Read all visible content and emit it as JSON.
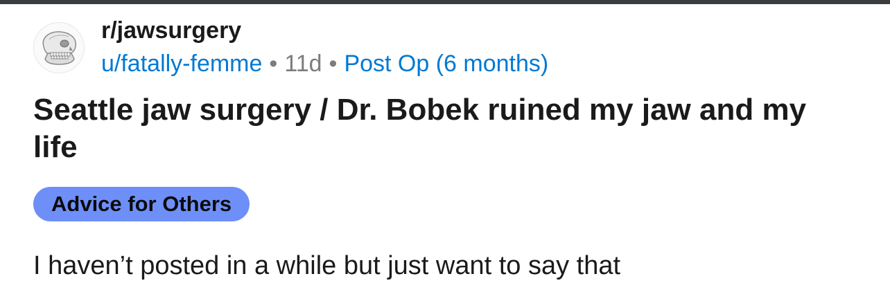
{
  "post": {
    "subreddit": "r/jawsurgery",
    "username": "u/fatally-femme",
    "separator": "•",
    "age": "11d",
    "flair": "Post Op (6 months)",
    "title": "Seattle jaw surgery / Dr. Bobek ruined my jaw and my life",
    "tag": "Advice for Others",
    "body_first_line": "I haven’t posted in a while but just want to say that"
  },
  "avatar": {
    "icon": "skull-jaw-icon"
  },
  "colors": {
    "top_strip": "#3a3d40",
    "link": "#0079d3",
    "muted": "#7c7c7c",
    "tag_bg": "#6e8ff8",
    "text": "#1a1a1b"
  }
}
